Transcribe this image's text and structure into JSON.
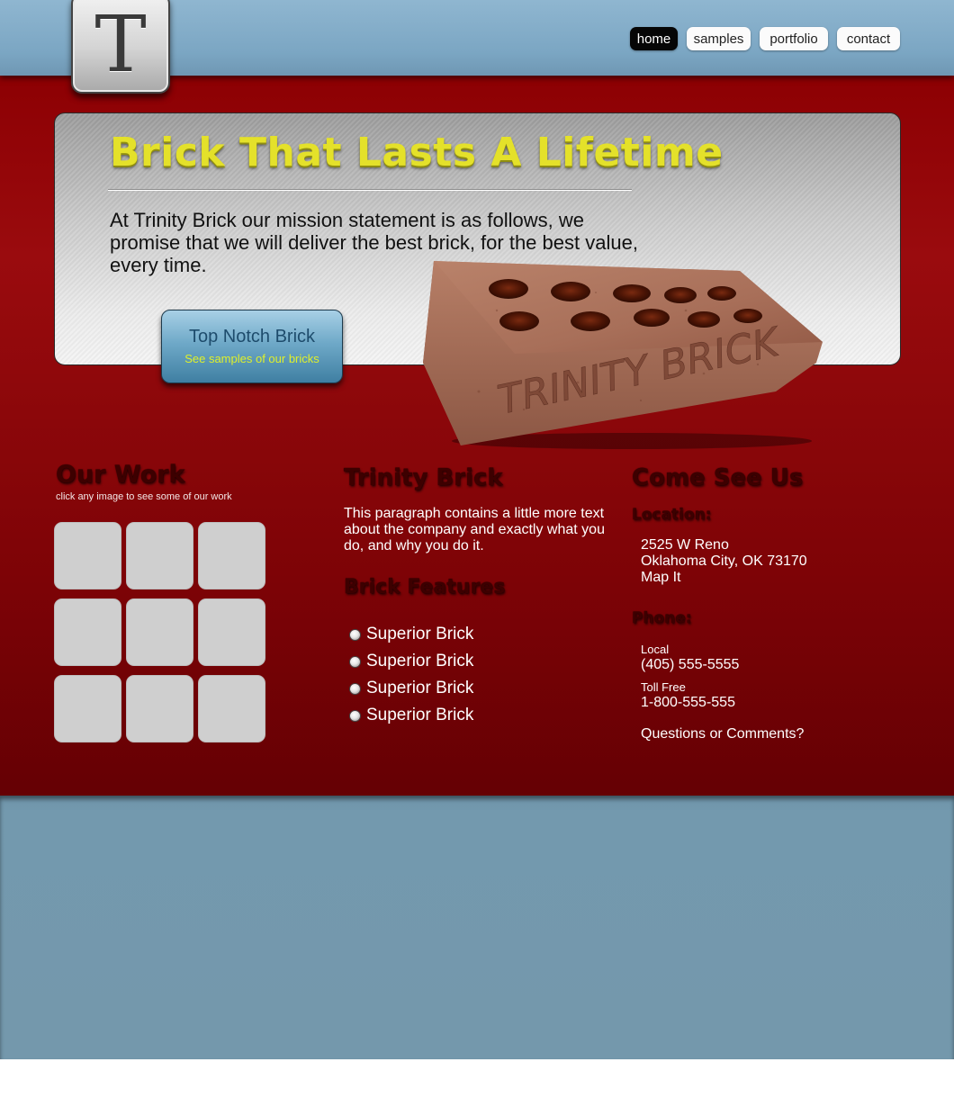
{
  "logo": {
    "letter": "T"
  },
  "nav": {
    "items": [
      {
        "label": "home",
        "active": true
      },
      {
        "label": "samples",
        "active": false
      },
      {
        "label": "portfolio",
        "active": false
      },
      {
        "label": "contact",
        "active": false
      }
    ]
  },
  "hero": {
    "title": "Brick That Lasts A Lifetime",
    "text": "At Trinity Brick our mission statement is as follows, we promise that we will deliver the best brick, for the best value, every time.",
    "cta_title": "Top Notch Brick",
    "cta_subtitle": "See samples of our bricks",
    "brick_stamp": "TRINITY BRICK"
  },
  "our_work": {
    "title": "Our Work",
    "subtitle": "click any image to see some of our work",
    "thumbnail_count": 9
  },
  "about": {
    "title": "Trinity Brick",
    "paragraph": "This paragraph contains a little more text about the company and exactly what you do, and why you do it.",
    "features_title": "Brick Features",
    "features": [
      "Superior Brick",
      "Superior Brick",
      "Superior Brick",
      "Superior Brick"
    ]
  },
  "contact": {
    "title": "Come See Us",
    "location_label": "Location:",
    "address_line1": "2525 W Reno",
    "address_line2": "Oklahoma City, OK 73170",
    "map_link": "Map It",
    "phone_label": "Phone:",
    "local_label": "Local",
    "local_number": "(405) 555-5555",
    "tollfree_label": "Toll Free",
    "tollfree_number": "1-800-555-555",
    "questions_link": "Questions or Comments?"
  },
  "colors": {
    "sky_blue": "#7ba6c3",
    "brick_red": "#8d0003",
    "title_yellow": "#e4e12a",
    "button_blue": "#6fa9c8",
    "footer_blue": "#7498ac"
  }
}
